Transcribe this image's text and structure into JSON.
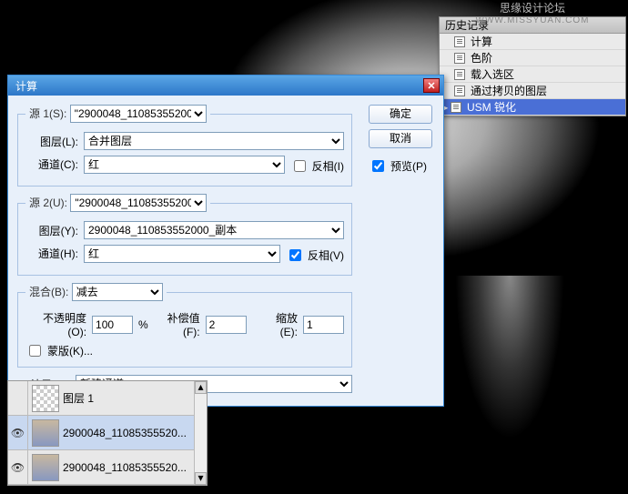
{
  "watermark": {
    "line1": "思缘设计论坛",
    "line2": "WWW.MISSYUAN.COM"
  },
  "dialog": {
    "title": "计算",
    "ok": "确定",
    "cancel": "取消",
    "preview_label": "预览(P)",
    "source1": {
      "legend": "源 1(S):",
      "image_value": "\"2900048_110853552000_\"...",
      "layer_label": "图层(L):",
      "layer_value": "合并图层",
      "channel_label": "通道(C):",
      "channel_value": "红",
      "invert_label": "反相(I)",
      "invert_checked": false
    },
    "source2": {
      "legend": "源 2(U):",
      "image_value": "\"2900048_110853552000_\"...",
      "layer_label": "图层(Y):",
      "layer_value": "2900048_110853552000_副本",
      "channel_label": "通道(H):",
      "channel_value": "红",
      "invert_label": "反相(V)",
      "invert_checked": true
    },
    "blend": {
      "legend": "混合(B):",
      "mode": "减去",
      "opacity_label": "不透明度(O):",
      "opacity_value": "100",
      "percent": "%",
      "offset_label": "补偿值(F):",
      "offset_value": "2",
      "scale_label": "缩放(E):",
      "scale_value": "1",
      "mask_label": "蒙版(K)...",
      "mask_checked": false
    },
    "result": {
      "label": "结果(R):",
      "value": "新建通道"
    }
  },
  "history": {
    "title": "历史记录",
    "items": [
      {
        "label": "计算"
      },
      {
        "label": "色阶"
      },
      {
        "label": "载入选区"
      },
      {
        "label": "通过拷贝的图层"
      },
      {
        "label": "USM 锐化",
        "selected": true
      }
    ]
  },
  "layers": {
    "items": [
      {
        "name": "图层 1",
        "visible": false,
        "selected": false,
        "checker": true
      },
      {
        "name": "2900048_11085355520...",
        "visible": true,
        "selected": true,
        "checker": false
      },
      {
        "name": "2900048_11085355520...",
        "visible": true,
        "selected": false,
        "checker": false
      }
    ]
  }
}
